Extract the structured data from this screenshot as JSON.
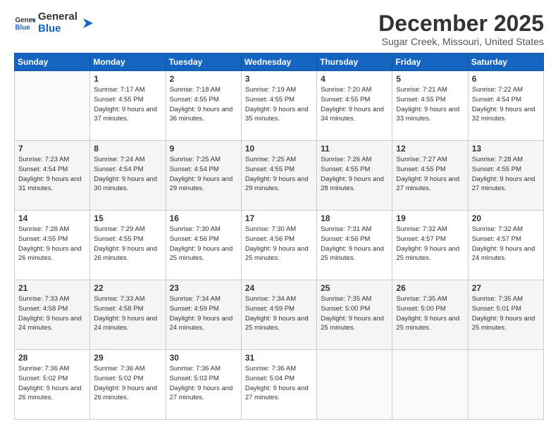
{
  "logo": {
    "general": "General",
    "blue": "Blue"
  },
  "header": {
    "month": "December 2025",
    "location": "Sugar Creek, Missouri, United States"
  },
  "weekdays": [
    "Sunday",
    "Monday",
    "Tuesday",
    "Wednesday",
    "Thursday",
    "Friday",
    "Saturday"
  ],
  "weeks": [
    [
      {
        "day": "",
        "empty": true
      },
      {
        "day": "1",
        "sunrise": "7:17 AM",
        "sunset": "4:55 PM",
        "daylight": "9 hours and 37 minutes."
      },
      {
        "day": "2",
        "sunrise": "7:18 AM",
        "sunset": "4:55 PM",
        "daylight": "9 hours and 36 minutes."
      },
      {
        "day": "3",
        "sunrise": "7:19 AM",
        "sunset": "4:55 PM",
        "daylight": "9 hours and 35 minutes."
      },
      {
        "day": "4",
        "sunrise": "7:20 AM",
        "sunset": "4:55 PM",
        "daylight": "9 hours and 34 minutes."
      },
      {
        "day": "5",
        "sunrise": "7:21 AM",
        "sunset": "4:55 PM",
        "daylight": "9 hours and 33 minutes."
      },
      {
        "day": "6",
        "sunrise": "7:22 AM",
        "sunset": "4:54 PM",
        "daylight": "9 hours and 32 minutes."
      }
    ],
    [
      {
        "day": "7",
        "sunrise": "7:23 AM",
        "sunset": "4:54 PM",
        "daylight": "9 hours and 31 minutes."
      },
      {
        "day": "8",
        "sunrise": "7:24 AM",
        "sunset": "4:54 PM",
        "daylight": "9 hours and 30 minutes."
      },
      {
        "day": "9",
        "sunrise": "7:25 AM",
        "sunset": "4:54 PM",
        "daylight": "9 hours and 29 minutes."
      },
      {
        "day": "10",
        "sunrise": "7:25 AM",
        "sunset": "4:55 PM",
        "daylight": "9 hours and 29 minutes."
      },
      {
        "day": "11",
        "sunrise": "7:26 AM",
        "sunset": "4:55 PM",
        "daylight": "9 hours and 28 minutes."
      },
      {
        "day": "12",
        "sunrise": "7:27 AM",
        "sunset": "4:55 PM",
        "daylight": "9 hours and 27 minutes."
      },
      {
        "day": "13",
        "sunrise": "7:28 AM",
        "sunset": "4:55 PM",
        "daylight": "9 hours and 27 minutes."
      }
    ],
    [
      {
        "day": "14",
        "sunrise": "7:28 AM",
        "sunset": "4:55 PM",
        "daylight": "9 hours and 26 minutes."
      },
      {
        "day": "15",
        "sunrise": "7:29 AM",
        "sunset": "4:55 PM",
        "daylight": "9 hours and 26 minutes."
      },
      {
        "day": "16",
        "sunrise": "7:30 AM",
        "sunset": "4:56 PM",
        "daylight": "9 hours and 25 minutes."
      },
      {
        "day": "17",
        "sunrise": "7:30 AM",
        "sunset": "4:56 PM",
        "daylight": "9 hours and 25 minutes."
      },
      {
        "day": "18",
        "sunrise": "7:31 AM",
        "sunset": "4:56 PM",
        "daylight": "9 hours and 25 minutes."
      },
      {
        "day": "19",
        "sunrise": "7:32 AM",
        "sunset": "4:57 PM",
        "daylight": "9 hours and 25 minutes."
      },
      {
        "day": "20",
        "sunrise": "7:32 AM",
        "sunset": "4:57 PM",
        "daylight": "9 hours and 24 minutes."
      }
    ],
    [
      {
        "day": "21",
        "sunrise": "7:33 AM",
        "sunset": "4:58 PM",
        "daylight": "9 hours and 24 minutes."
      },
      {
        "day": "22",
        "sunrise": "7:33 AM",
        "sunset": "4:58 PM",
        "daylight": "9 hours and 24 minutes."
      },
      {
        "day": "23",
        "sunrise": "7:34 AM",
        "sunset": "4:59 PM",
        "daylight": "9 hours and 24 minutes."
      },
      {
        "day": "24",
        "sunrise": "7:34 AM",
        "sunset": "4:59 PM",
        "daylight": "9 hours and 25 minutes."
      },
      {
        "day": "25",
        "sunrise": "7:35 AM",
        "sunset": "5:00 PM",
        "daylight": "9 hours and 25 minutes."
      },
      {
        "day": "26",
        "sunrise": "7:35 AM",
        "sunset": "5:00 PM",
        "daylight": "9 hours and 25 minutes."
      },
      {
        "day": "27",
        "sunrise": "7:35 AM",
        "sunset": "5:01 PM",
        "daylight": "9 hours and 25 minutes."
      }
    ],
    [
      {
        "day": "28",
        "sunrise": "7:36 AM",
        "sunset": "5:02 PM",
        "daylight": "9 hours and 26 minutes."
      },
      {
        "day": "29",
        "sunrise": "7:36 AM",
        "sunset": "5:02 PM",
        "daylight": "9 hours and 26 minutes."
      },
      {
        "day": "30",
        "sunrise": "7:36 AM",
        "sunset": "5:03 PM",
        "daylight": "9 hours and 27 minutes."
      },
      {
        "day": "31",
        "sunrise": "7:36 AM",
        "sunset": "5:04 PM",
        "daylight": "9 hours and 27 minutes."
      },
      {
        "day": "",
        "empty": true
      },
      {
        "day": "",
        "empty": true
      },
      {
        "day": "",
        "empty": true
      }
    ]
  ]
}
